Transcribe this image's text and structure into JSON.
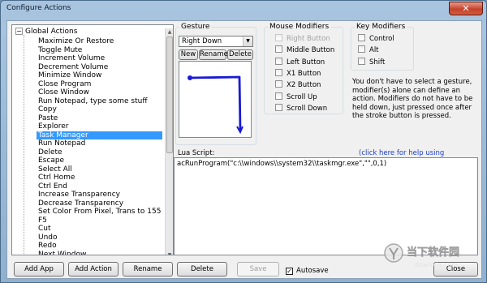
{
  "window": {
    "title": "Configure Actions",
    "close_label": "✕"
  },
  "tree": {
    "root_label": "Global Actions",
    "expander": "−",
    "selected_index": 13,
    "items": [
      "Maximize Or Restore",
      "Toggle Mute",
      "Increment Volume",
      "Decrement Volume",
      "Minimize Window",
      "Close Program",
      "Close Window",
      "Run Notepad, type some stuff",
      "Copy",
      "Paste",
      "Explorer",
      "Task Manager",
      "Run Notepad",
      "Delete",
      "Escape",
      "Select All",
      "Ctrl Home",
      "Ctrl End",
      "Increase Transparency",
      "Decrease Transparency",
      "Set Color From Pixel, Trans to 155",
      "F5",
      "Cut",
      "Undo",
      "Redo",
      "Next Window"
    ]
  },
  "gesture": {
    "legend": "Gesture",
    "selected": "Right Down",
    "new_label": "New",
    "rename_label": "Rename",
    "delete_label": "Delete",
    "stroke_color": "#1a1ad6"
  },
  "mouse_modifiers": {
    "legend": "Mouse Modifiers",
    "items": [
      {
        "label": "Right Button",
        "disabled": true
      },
      {
        "label": "Middle Button",
        "disabled": false
      },
      {
        "label": "Left Button",
        "disabled": false
      },
      {
        "label": "X1 Button",
        "disabled": false
      },
      {
        "label": "X2 Button",
        "disabled": false
      },
      {
        "label": "Scroll Up",
        "disabled": false
      },
      {
        "label": "Scroll Down",
        "disabled": false
      }
    ]
  },
  "key_modifiers": {
    "legend": "Key Modifiers",
    "items": [
      "Control",
      "Alt",
      "Shift"
    ]
  },
  "info_text": "You don't have to select a gesture, modifier(s) alone can define an action. Modifiers do not have to be held down, just pressed once after the stroke button is pressed.",
  "lua": {
    "label": "Lua Script:",
    "help_link": "(click here for help using StrokesPlus)",
    "script": "acRunProgram(\"c:\\\\windows\\\\system32\\\\taskmgr.exe\",\"\",0,1)"
  },
  "bottom": {
    "add_app": "Add App",
    "add_action": "Add Action",
    "rename": "Rename",
    "delete": "Delete",
    "save": "Save",
    "autosave": "Autosave",
    "autosave_checked": "✓",
    "close": "Close"
  },
  "watermark": {
    "brand": "当下软件园",
    "url": "downxia.com"
  }
}
